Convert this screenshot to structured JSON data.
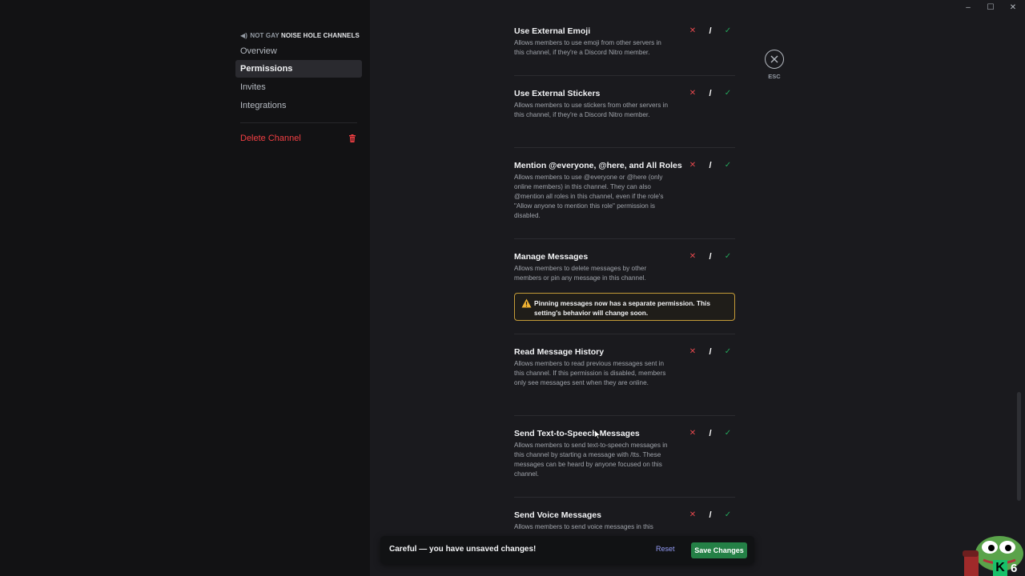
{
  "window_controls": {
    "minimize": "–",
    "maximize": "☐",
    "close": "✕"
  },
  "sidebar": {
    "header_prefix": "NOT GAY",
    "header_accent": "NOISE HOLE CHANNELS",
    "items": [
      {
        "label": "Overview",
        "active": false
      },
      {
        "label": "Permissions",
        "active": true
      },
      {
        "label": "Invites",
        "active": false
      },
      {
        "label": "Integrations",
        "active": false
      }
    ],
    "delete_label": "Delete Channel"
  },
  "close": {
    "esc_label": "ESC"
  },
  "permissions": [
    {
      "title": "Use External Emoji",
      "description": "Allows members to use emoji from other servers in this channel, if they're a Discord Nitro member."
    },
    {
      "title": "Use External Stickers",
      "description": "Allows members to use stickers from other servers in this channel, if they're a Discord Nitro member."
    },
    {
      "title": "Mention @everyone, @here, and All Roles",
      "description": "Allows members to use @everyone or @here (only online members) in this channel. They can also @mention all roles in this channel, even if the role's \"Allow anyone to mention this role\" permission is disabled."
    },
    {
      "title": "Manage Messages",
      "description": "Allows members to delete messages by other members or pin any message in this channel."
    },
    {
      "title": "Read Message History",
      "description": "Allows members to read previous messages sent in this channel. If this permission is disabled, members only see messages sent when they are online."
    },
    {
      "title": "Send Text-to-Speech Messages",
      "description": "Allows members to send text-to-speech messages in this channel by starting a message with /tts. These messages can be heard by anyone focused on this channel."
    },
    {
      "title": "Send Voice Messages",
      "description": "Allows members to send voice messages in this"
    }
  ],
  "tri_state": {
    "deny": "✕",
    "neutral": "/",
    "allow": "✓"
  },
  "warning": {
    "text": "Pinning messages now has a separate permission. This setting's behavior will change soon."
  },
  "notice": {
    "text": "Careful — you have unsaved changes!",
    "reset_label": "Reset",
    "save_label": "Save Changes"
  },
  "overlay": {
    "badge_letter": "K",
    "badge_number": "6"
  },
  "colors": {
    "background": "#1a1a1e",
    "sidebar": "#121214",
    "danger": "#f23f43",
    "allow": "#23a55a",
    "save": "#248046",
    "warning_border": "#c49b38",
    "link": "#949cf7"
  }
}
